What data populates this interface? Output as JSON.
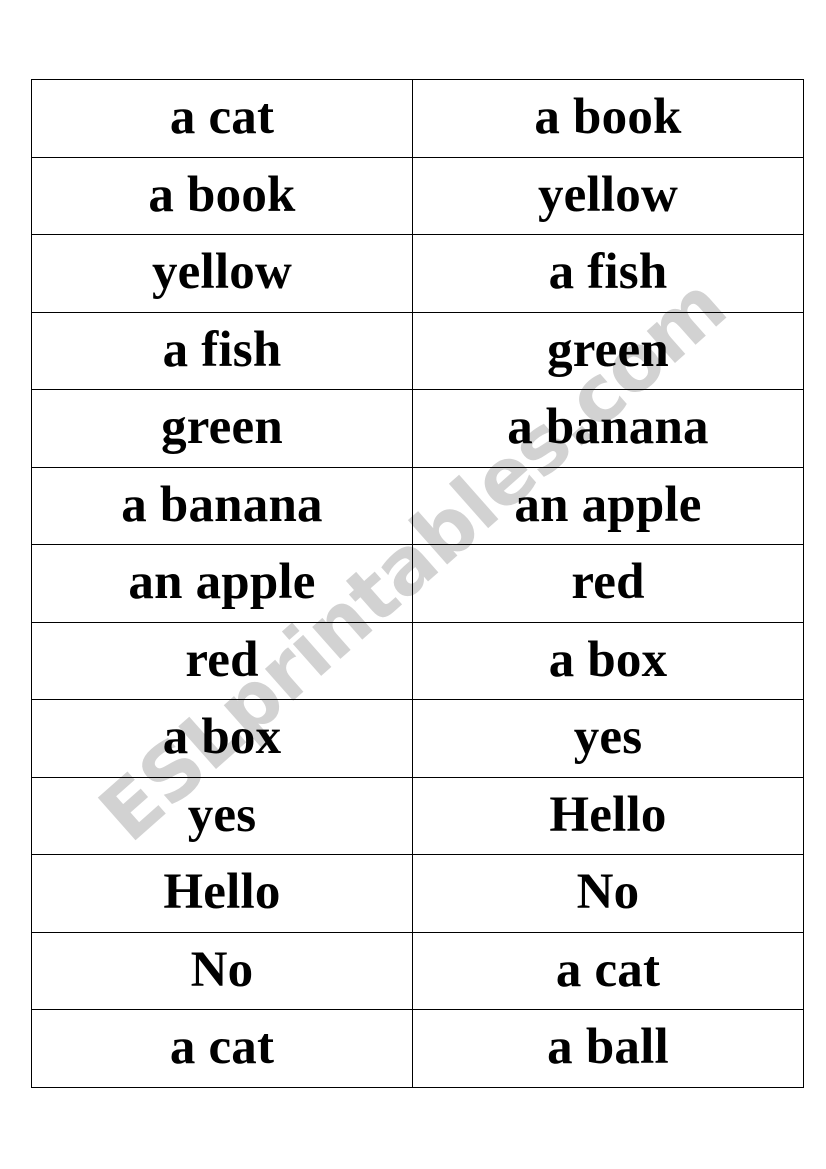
{
  "document": {
    "type": "word-card-worksheet",
    "background_color": "#ffffff",
    "text_color": "#000000",
    "border_color": "#000000"
  },
  "watermark": {
    "text": "ESLprintables.com",
    "color": "#d2d2d2",
    "rotation_degrees": -41.5
  },
  "table": {
    "columns": 2,
    "rows": 13,
    "rows_data": [
      {
        "left": "a cat",
        "right": "a book"
      },
      {
        "left": "a book",
        "right": "yellow"
      },
      {
        "left": "yellow",
        "right": "a fish"
      },
      {
        "left": "a fish",
        "right": "green"
      },
      {
        "left": "green",
        "right": "a banana"
      },
      {
        "left": "a banana",
        "right": "an apple"
      },
      {
        "left": "an apple",
        "right": "red"
      },
      {
        "left": "red",
        "right": "a box"
      },
      {
        "left": "a box",
        "right": "yes"
      },
      {
        "left": "yes",
        "right": "Hello"
      },
      {
        "left": "Hello",
        "right": "No"
      },
      {
        "left": "No",
        "right": "a cat"
      },
      {
        "left": "a cat",
        "right": "a ball"
      }
    ]
  }
}
